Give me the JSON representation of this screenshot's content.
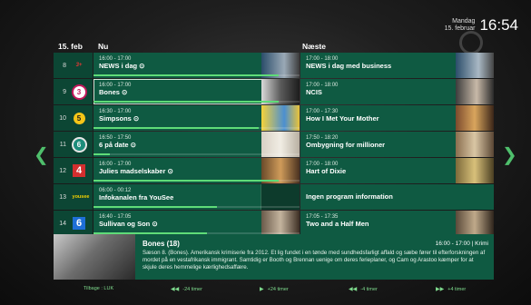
{
  "clock": {
    "day": "Mandag",
    "date": "15. februar",
    "time": "16:54"
  },
  "header": {
    "date_label": "15. feb",
    "now_label": "Nu",
    "next_label": "Næste"
  },
  "channels": [
    {
      "num": "8",
      "logo": "tv3plus-logo",
      "logo_text": "3+",
      "now": {
        "time": "16:00 - 17:00",
        "title": "NEWS i dag ⊙",
        "progress": 0.9
      },
      "next": {
        "time": "17:00 - 18:00",
        "title": "NEWS i dag med business"
      }
    },
    {
      "num": "9",
      "logo": "tv3-puls-logo",
      "logo_text": "3",
      "now": {
        "time": "16:00 - 17:00",
        "title": "Bones ⊙",
        "progress": 0.9
      },
      "next": {
        "time": "17:00 - 18:00",
        "title": "NCIS"
      }
    },
    {
      "num": "10",
      "logo": "kanal5-logo",
      "logo_text": "5",
      "now": {
        "time": "16:30 - 17:00",
        "title": "Simpsons ⊙",
        "progress": 0.8
      },
      "next": {
        "time": "17:00 - 17:30",
        "title": "How I Met Your Mother"
      }
    },
    {
      "num": "11",
      "logo": "6eren-logo",
      "logo_text": "6",
      "now": {
        "time": "16:50 - 17:50",
        "title": "6 på date ⊙",
        "progress": 0.08
      },
      "next": {
        "time": "17:50 - 18:20",
        "title": "Ombygning for millioner"
      }
    },
    {
      "num": "12",
      "logo": "tv2-logo",
      "logo_text": "4",
      "now": {
        "time": "16:00 - 17:00",
        "title": "Julies madselskaber ⊙",
        "progress": 0.9
      },
      "next": {
        "time": "17:00 - 18:00",
        "title": "Hart of Dixie"
      }
    },
    {
      "num": "13",
      "logo": "yousee-logo",
      "logo_text": "yousee",
      "now": {
        "time": "06:00 - 00:12",
        "title": "Infokanalen fra YouSee",
        "progress": 0.6
      },
      "next": {
        "time": "",
        "title": "Ingen program information"
      }
    },
    {
      "num": "14",
      "logo": "kanal6-logo",
      "logo_text": "6",
      "now": {
        "time": "16:40 - 17:05",
        "title": "Sullivan og Son ⊙",
        "progress": 0.55
      },
      "next": {
        "time": "17:05 - 17:35",
        "title": "Two and a Half Men"
      }
    }
  ],
  "info": {
    "title": "Bones (18)",
    "meta": "16:00 - 17:00 | Krimi",
    "description": "Sæson 8. (Bones). Amerikansk krimiserie fra 2012. Et lig fundet i en tønde med sundhedsfarligt affald og sæbe fører til efterforskningen af mordet på en vestafrikansk immigrant. Samtidig er Booth og Brennan uenige om deres ferieplaner, og Cam og Arastoo kæmper for at skjule deres hemmelige kærlighedsaffære."
  },
  "footer": [
    {
      "icon": "",
      "label": "Tilbage : LUK"
    },
    {
      "icon": "◀◀",
      "label": "-24 timer"
    },
    {
      "icon": "▶",
      "label": "+24 timer"
    },
    {
      "icon": "◀◀",
      "label": "-4 timer"
    },
    {
      "icon": "▶▶",
      "label": "+4 timer"
    }
  ],
  "colors": {
    "accent": "#4fbf6c",
    "cell": "#0f5a42",
    "progress": "#5fdc78"
  }
}
